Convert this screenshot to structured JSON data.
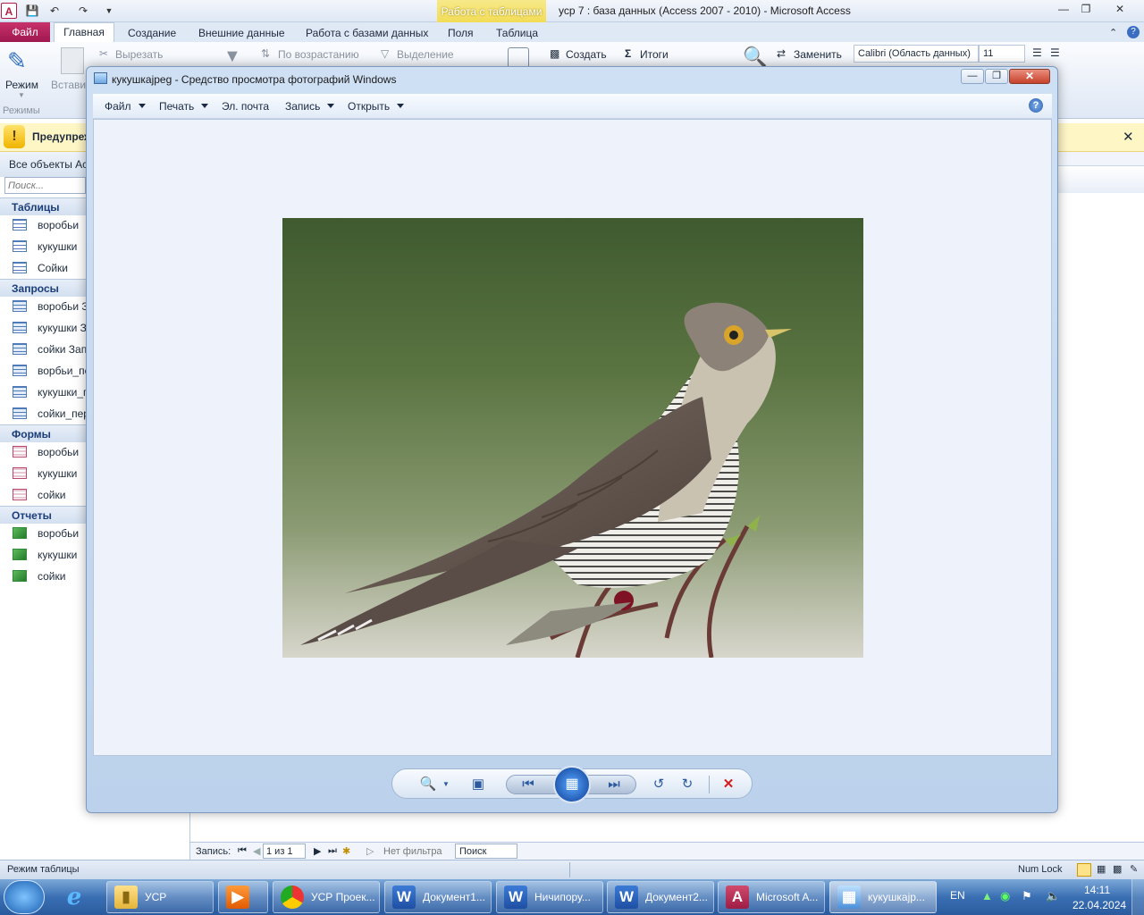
{
  "access": {
    "title": "усp 7 : база данных (Access 2007 - 2010)  -  Microsoft Access",
    "context_tab": "Работа с таблицами",
    "tabs": [
      "Файл",
      "Главная",
      "Создание",
      "Внешние данные",
      "Работа с базами данных",
      "Поля",
      "Таблица"
    ],
    "ribbon": {
      "mode": "Режим",
      "paste": "Вставить",
      "cut": "Вырезать",
      "sort_asc": "По возрастанию",
      "selection": "Выделение",
      "create": "Создать",
      "totals": "Итоги",
      "replace": "Заменить",
      "font": "Calibri (Область данных)",
      "font_size": "11",
      "group_modes": "Режимы"
    },
    "warning": "Предупреждение",
    "nav": {
      "header": "Все объекты Access",
      "search_placeholder": "Поиск...",
      "groups": [
        {
          "title": "Таблицы",
          "items": [
            "воробьи",
            "кукушки",
            "Сойки"
          ]
        },
        {
          "title": "Запросы",
          "items": [
            "воробьи Запрос",
            "кукушки Запрос",
            "сойки Запрос",
            "ворбьи_перекрестный",
            "кукушки_перекрестный",
            "сойки_перекрестный"
          ]
        },
        {
          "title": "Формы",
          "items": [
            "воробьи",
            "кукушки",
            "сойки"
          ]
        },
        {
          "title": "Отчеты",
          "items": [
            "воробьи",
            "кукушки",
            "сойки"
          ]
        }
      ]
    },
    "recordbar": {
      "label": "Запись:",
      "position": "1 из 1",
      "filter": "Нет фильтра",
      "search": "Поиск"
    },
    "status": {
      "left": "Режим таблицы",
      "numlock": "Num Lock"
    }
  },
  "viewer": {
    "title": "кукушкаjpeg - Средство просмотра фотографий Windows",
    "menu": [
      "Файл",
      "Печать",
      "Эл. почта",
      "Запись",
      "Открыть"
    ],
    "menu_has_caret": [
      true,
      true,
      false,
      true,
      true
    ]
  },
  "taskbar": {
    "items": [
      {
        "label": "УСР",
        "icon": "folder-icon"
      },
      {
        "label": "",
        "icon": "media-player-icon"
      },
      {
        "label": "УСР Проек...",
        "icon": "chrome-icon"
      },
      {
        "label": "Документ1...",
        "icon": "word-icon"
      },
      {
        "label": "Ничипору...",
        "icon": "word-icon"
      },
      {
        "label": "Документ2...",
        "icon": "word-icon"
      },
      {
        "label": "Microsoft A...",
        "icon": "access-icon"
      },
      {
        "label": "кукушкаjp...",
        "icon": "photo-viewer-icon"
      }
    ],
    "lang": "EN",
    "time": "14:11",
    "date": "22.04.2024"
  }
}
